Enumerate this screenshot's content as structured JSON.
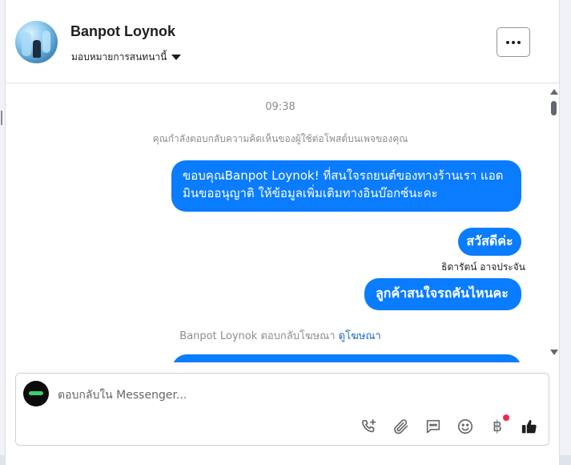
{
  "header": {
    "name": "Banpot Loynok",
    "assignment": "มอบหมายการสนทนานี้"
  },
  "thread": {
    "timestamp": "09:38",
    "notice": "คุณกำลังตอบกลับความคิดเห็นของผู้ใช้ต่อโพสต์บนเพจของคุณ",
    "messages": [
      {
        "text": "ขอบคุณBanpot Loynok! ที่สนใจรถยนต์ของทางร้านเรา แอดมินขออนุญาติ ให้ข้อมูลเพิ่มเติมทางอินบ๊อกซ์นะคะ"
      },
      {
        "text": "สวัสดีค่ะ"
      },
      {
        "text": "ลูกค้าสนใจรถคันไหนคะ"
      }
    ],
    "sender_name": "ธิดารัตน์ อาจประจัน",
    "reply_note": "Banpot Loynok ตอบกลับโฆษณา",
    "view_ad_link": "ดูโฆษณา"
  },
  "composer": {
    "placeholder": "ตอบกลับใน Messenger..."
  },
  "colors": {
    "bubble": "#0a7cff",
    "link": "#1e6ad4",
    "notification_dot": "#f02849"
  },
  "icons": [
    "phone-add-icon",
    "paperclip-icon",
    "saved-reply-icon",
    "emoji-icon",
    "baht-icon",
    "thumbs-up-icon"
  ]
}
